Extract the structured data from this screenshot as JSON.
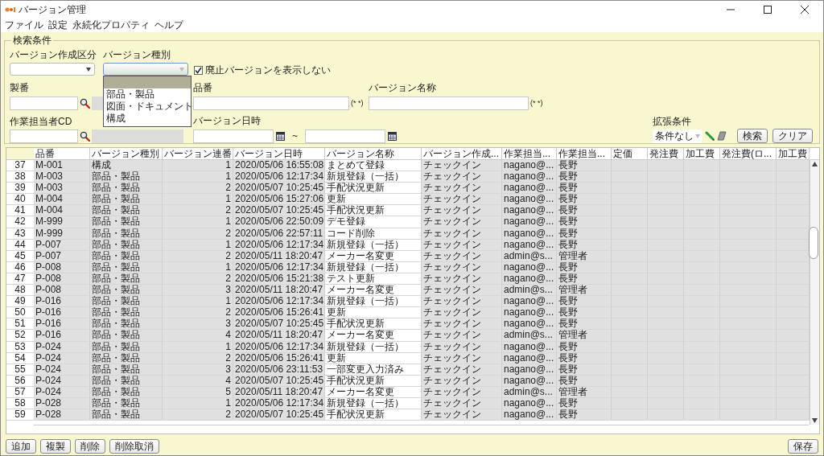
{
  "window": {
    "title": "バージョン管理"
  },
  "menu": [
    "ファイル",
    "設定",
    "永続化プロパティ",
    "ヘルプ"
  ],
  "search": {
    "legend": "検索条件",
    "creation_type": {
      "label": "バージョン作成区分"
    },
    "version_kind": {
      "label": "バージョン種別",
      "focused": true,
      "open": true,
      "options": [
        {
          "selected": true
        },
        {
          "label": "部品・製品",
          "selected": false
        },
        {
          "label": "図面・ドキュメント",
          "selected": false
        },
        {
          "label": "構成",
          "selected": false
        }
      ]
    },
    "hide_obsolete": {
      "label": "廃止バージョンを表示しない",
      "checked": true
    },
    "serial": {
      "label": "製番"
    },
    "part_no": {
      "label": "品番",
      "note": "(* *)"
    },
    "version_name": {
      "label": "バージョン名称",
      "note": "(* *)"
    },
    "worker_cd": {
      "label": "作業担当者CD"
    },
    "version_date": {
      "label": "バージョン日時",
      "separator": "~"
    },
    "extended": {
      "label": "拡張条件",
      "value": "条件なし"
    },
    "buttons": [
      "検索",
      "クリア"
    ]
  },
  "table": {
    "columns": [
      {
        "label": "品番",
        "kind": "text",
        "editable": false
      },
      {
        "label": "バージョン種別",
        "kind": "text",
        "editable": false
      },
      {
        "label": "バージョン連番",
        "kind": "number",
        "editable": false
      },
      {
        "label": "バージョン日時",
        "kind": "text",
        "editable": false
      },
      {
        "label": "バージョン名称",
        "kind": "text",
        "editable": true
      },
      {
        "label": "バージョン作成...",
        "kind": "text",
        "editable": false
      },
      {
        "label": "作業担当...",
        "kind": "text",
        "editable": false
      },
      {
        "label": "作業担当...",
        "kind": "text",
        "editable": false
      },
      {
        "label": "定価",
        "kind": "text",
        "editable": false
      },
      {
        "label": "発注費",
        "kind": "text",
        "editable": false
      },
      {
        "label": "加工費",
        "kind": "text",
        "editable": false
      },
      {
        "label": "発注費(ロ...",
        "kind": "text",
        "editable": false
      },
      {
        "label": "加工費",
        "kind": "text",
        "editable": false
      }
    ],
    "rows": [
      {
        "number": "37",
        "cells": [
          "M-001",
          "構成",
          "1",
          "2020/05/06 16:55:08",
          "まとめて登録",
          "チェックイン",
          "nagano@...",
          "長野"
        ]
      },
      {
        "number": "38",
        "cells": [
          "M-003",
          "部品・製品",
          "1",
          "2020/05/06 12:17:34",
          "新規登録（一括）",
          "チェックイン",
          "nagano@...",
          "長野"
        ]
      },
      {
        "number": "39",
        "cells": [
          "M-003",
          "部品・製品",
          "2",
          "2020/05/07 10:25:45",
          "手配状況更新",
          "チェックイン",
          "nagano@...",
          "長野"
        ]
      },
      {
        "number": "40",
        "cells": [
          "M-004",
          "部品・製品",
          "1",
          "2020/05/06 15:27:06",
          "更新",
          "チェックイン",
          "nagano@...",
          "長野"
        ]
      },
      {
        "number": "41",
        "cells": [
          "M-004",
          "部品・製品",
          "2",
          "2020/05/07 10:25:45",
          "手配状況更新",
          "チェックイン",
          "nagano@...",
          "長野"
        ]
      },
      {
        "number": "42",
        "cells": [
          "M-999",
          "部品・製品",
          "1",
          "2020/05/06 22:50:09",
          "デモ登録",
          "チェックイン",
          "nagano@...",
          "長野"
        ]
      },
      {
        "number": "43",
        "cells": [
          "M-999",
          "部品・製品",
          "2",
          "2020/05/06 22:57:11",
          "コード削除",
          "チェックイン",
          "nagano@...",
          "長野"
        ]
      },
      {
        "number": "44",
        "cells": [
          "P-007",
          "部品・製品",
          "1",
          "2020/05/06 12:17:34",
          "新規登録（一括）",
          "チェックイン",
          "nagano@...",
          "長野"
        ]
      },
      {
        "number": "45",
        "cells": [
          "P-007",
          "部品・製品",
          "2",
          "2020/05/11 18:20:47",
          "メーカー名変更",
          "チェックイン",
          "admin@s...",
          "管理者"
        ]
      },
      {
        "number": "46",
        "cells": [
          "P-008",
          "部品・製品",
          "1",
          "2020/05/06 12:17:34",
          "新規登録（一括）",
          "チェックイン",
          "nagano@...",
          "長野"
        ]
      },
      {
        "number": "47",
        "cells": [
          "P-008",
          "部品・製品",
          "2",
          "2020/05/06 15:21:38",
          "テスト更新",
          "チェックイン",
          "nagano@...",
          "長野"
        ]
      },
      {
        "number": "48",
        "cells": [
          "P-008",
          "部品・製品",
          "3",
          "2020/05/11 18:20:47",
          "メーカー名変更",
          "チェックイン",
          "admin@s...",
          "管理者"
        ]
      },
      {
        "number": "49",
        "cells": [
          "P-016",
          "部品・製品",
          "1",
          "2020/05/06 12:17:34",
          "新規登録（一括）",
          "チェックイン",
          "nagano@...",
          "長野"
        ]
      },
      {
        "number": "50",
        "cells": [
          "P-016",
          "部品・製品",
          "2",
          "2020/05/06 15:26:41",
          "更新",
          "チェックイン",
          "nagano@...",
          "長野"
        ]
      },
      {
        "number": "51",
        "cells": [
          "P-016",
          "部品・製品",
          "3",
          "2020/05/07 10:25:45",
          "手配状況更新",
          "チェックイン",
          "nagano@...",
          "長野"
        ]
      },
      {
        "number": "52",
        "cells": [
          "P-016",
          "部品・製品",
          "4",
          "2020/05/11 18:20:47",
          "メーカー名変更",
          "チェックイン",
          "admin@s...",
          "管理者"
        ]
      },
      {
        "number": "53",
        "cells": [
          "P-024",
          "部品・製品",
          "1",
          "2020/05/06 12:17:34",
          "新規登録（一括）",
          "チェックイン",
          "nagano@...",
          "長野"
        ]
      },
      {
        "number": "54",
        "cells": [
          "P-024",
          "部品・製品",
          "2",
          "2020/05/06 15:26:41",
          "更新",
          "チェックイン",
          "nagano@...",
          "長野"
        ]
      },
      {
        "number": "55",
        "cells": [
          "P-024",
          "部品・製品",
          "3",
          "2020/05/06 23:11:53",
          "一部変更入力済み",
          "チェックイン",
          "nagano@...",
          "長野"
        ]
      },
      {
        "number": "56",
        "cells": [
          "P-024",
          "部品・製品",
          "4",
          "2020/05/07 10:25:45",
          "手配状況更新",
          "チェックイン",
          "nagano@...",
          "長野"
        ]
      },
      {
        "number": "57",
        "cells": [
          "P-024",
          "部品・製品",
          "5",
          "2020/05/11 18:20:47",
          "メーカー名変更",
          "チェックイン",
          "admin@s...",
          "管理者"
        ]
      },
      {
        "number": "58",
        "cells": [
          "P-028",
          "部品・製品",
          "1",
          "2020/05/06 12:17:34",
          "新規登録（一括）",
          "チェックイン",
          "nagano@...",
          "長野"
        ]
      },
      {
        "number": "59",
        "cells": [
          "P-028",
          "部品・製品",
          "2",
          "2020/05/07 10:25:45",
          "手配状況更新",
          "チェックイン",
          "nagano@...",
          "長野"
        ]
      }
    ]
  },
  "actions_left": [
    "追加",
    "複製",
    "削除",
    "削除取消"
  ],
  "actions_right": [
    "保存"
  ]
}
